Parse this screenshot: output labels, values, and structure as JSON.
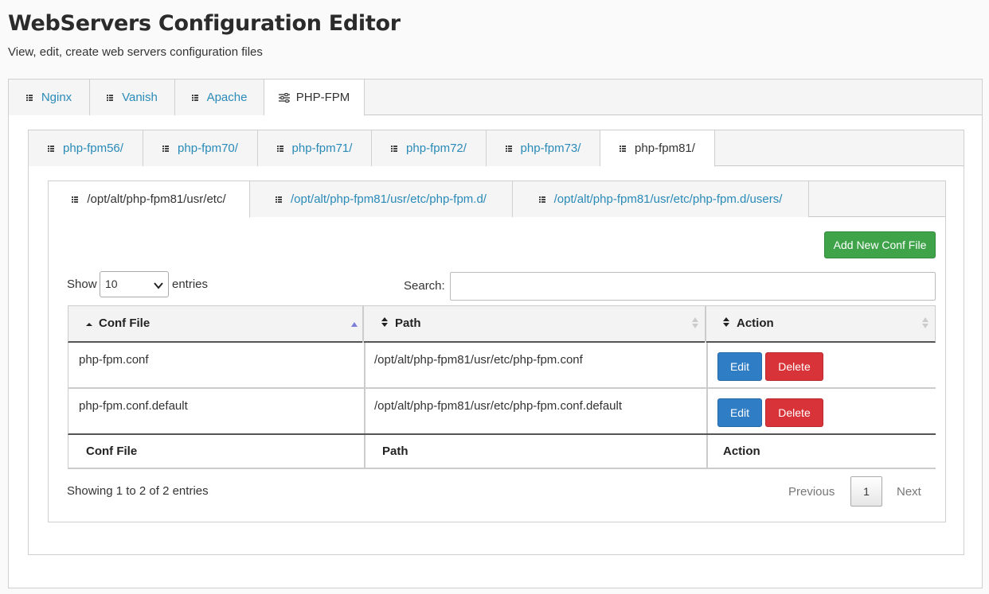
{
  "header": {
    "title": "WebServers Configuration Editor",
    "subtitle": "View, edit, create web servers configuration files"
  },
  "server_tabs": [
    {
      "label": "Nginx",
      "icon": "list-icon"
    },
    {
      "label": "Vanish",
      "icon": "list-icon"
    },
    {
      "label": "Apache",
      "icon": "list-icon"
    },
    {
      "label": "PHP-FPM",
      "icon": "sliders-icon",
      "active": true
    }
  ],
  "version_tabs": [
    {
      "label": "php-fpm56/"
    },
    {
      "label": "php-fpm70/"
    },
    {
      "label": "php-fpm71/"
    },
    {
      "label": "php-fpm72/"
    },
    {
      "label": "php-fpm73/"
    },
    {
      "label": "php-fpm81/",
      "active": true
    }
  ],
  "path_tabs": [
    {
      "label": "/opt/alt/php-fpm81/usr/etc/",
      "active": true
    },
    {
      "label": "/opt/alt/php-fpm81/usr/etc/php-fpm.d/"
    },
    {
      "label": "/opt/alt/php-fpm81/usr/etc/php-fpm.d/users/"
    }
  ],
  "toolbar": {
    "add_label": "Add New Conf File"
  },
  "table_controls": {
    "show_label": "Show",
    "entries_value": "10",
    "entries_label": "entries",
    "search_label": "Search:",
    "search_value": ""
  },
  "table": {
    "columns": [
      "Conf File",
      "Path",
      "Action"
    ],
    "rows": [
      {
        "file": "php-fpm.conf",
        "path": "/opt/alt/php-fpm81/usr/etc/php-fpm.conf",
        "edit": "Edit",
        "delete": "Delete"
      },
      {
        "file": "php-fpm.conf.default",
        "path": "/opt/alt/php-fpm81/usr/etc/php-fpm.conf.default",
        "edit": "Edit",
        "delete": "Delete"
      }
    ],
    "footer": [
      "Conf File",
      "Path",
      "Action"
    ]
  },
  "pagination": {
    "info": "Showing 1 to 2 of 2 entries",
    "previous": "Previous",
    "page": "1",
    "next": "Next"
  },
  "colors": {
    "link": "#2a8ab8",
    "add_button": "#3fa34a",
    "edit_button": "#2f7dc4",
    "delete_button": "#d83339"
  }
}
